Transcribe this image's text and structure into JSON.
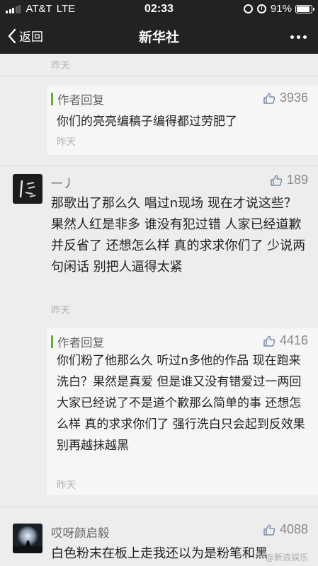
{
  "status_bar": {
    "carrier": "AT&T",
    "network": "LTE",
    "time": "02:33",
    "battery": "91%",
    "battery_level": 0.91
  },
  "nav": {
    "back_label": "返回",
    "title": "新华社"
  },
  "top_time": "昨天",
  "reply1": {
    "label": "作者回复",
    "likes": "3936",
    "text": "你们的亮亮编稿子编得都过劳肥了",
    "time": "昨天"
  },
  "comment1": {
    "name": "一丿",
    "likes": "189",
    "text": "那歌出了那么久 唱过n现场 现在才说这些？果然人红是非多 谁没有犯过错 人家已经道歉并反省了 还想怎么样 真的求求你们了 少说两句闲话 别把人逼得太紧",
    "time": "昨天"
  },
  "reply2": {
    "label": "作者回复",
    "likes": "4416",
    "text": "你们粉了他那么久  听过n多他的作品 现在跑来洗白？果然是真爱  但是谁又没有错爱过一两回  大家已经说了不是道个歉那么简单的事  还想怎么样  真的求求你们了  强行洗白只会起到反效果  别再越抹越黑",
    "time": "昨天"
  },
  "comment2": {
    "name": "哎呀颜启毅",
    "likes": "4088",
    "text": "白色粉末在板上走我还以为是粉笔和黑"
  },
  "watermark": "@新浪娱乐"
}
